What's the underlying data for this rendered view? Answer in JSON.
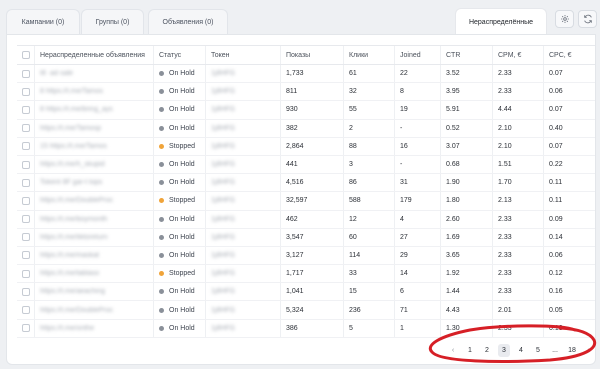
{
  "tabs": [
    {
      "label": "Кампании (0)",
      "active": false
    },
    {
      "label": "Группы (0)",
      "active": false
    },
    {
      "label": "Объявления (0)",
      "active": false
    },
    {
      "label": "Нераспределённые",
      "active": true
    }
  ],
  "toolbar": {
    "settings_icon": "gear-icon",
    "refresh_icon": "refresh-icon"
  },
  "table": {
    "headers": {
      "name": "Нераспределенные объявления",
      "status": "Статус",
      "token": "Токен",
      "shows": "Показы",
      "clicks": "Клики",
      "joined": "Joined",
      "ctr": "CTR",
      "cpm": "CPM, €",
      "cpc": "CPC, €"
    },
    "rows": [
      {
        "name": "t8 ·ad·sale",
        "status": "On Hold",
        "token": "1j8HFG",
        "shows": "1,733",
        "clicks": "61",
        "joined": "22",
        "ctr": "3.52",
        "cpm": "2.33",
        "cpc": "0.07"
      },
      {
        "name": "8 https://t.me/Tamos",
        "status": "On Hold",
        "token": "1j8HFG",
        "shows": "811",
        "clicks": "32",
        "joined": "8",
        "ctr": "3.95",
        "cpm": "2.33",
        "cpc": "0.06"
      },
      {
        "name": "8 https://t.me/bring_ays",
        "status": "On Hold",
        "token": "1j8HFG",
        "shows": "930",
        "clicks": "55",
        "joined": "19",
        "ctr": "5.91",
        "cpm": "4.44",
        "cpc": "0.07"
      },
      {
        "name": "https://t.me/Tamosp",
        "status": "On Hold",
        "token": "1j8HFG",
        "shows": "382",
        "clicks": "2",
        "joined": "-",
        "ctr": "0.52",
        "cpm": "2.10",
        "cpc": "0.40"
      },
      {
        "name": "15 https://t.me/Tamos",
        "status": "Stopped",
        "token": "1j8HFG",
        "shows": "2,864",
        "clicks": "88",
        "joined": "16",
        "ctr": "3.07",
        "cpm": "2.10",
        "cpc": "0.07"
      },
      {
        "name": "https://t.me/h_skupid",
        "status": "On Hold",
        "token": "1j8HFG",
        "shows": "441",
        "clicks": "3",
        "joined": "-",
        "ctr": "0.68",
        "cpm": "1.51",
        "cpc": "0.22"
      },
      {
        "name": "Tokent 8F gar-t tops",
        "status": "On Hold",
        "token": "1j8HFG",
        "shows": "4,516",
        "clicks": "86",
        "joined": "31",
        "ctr": "1.90",
        "cpm": "1.70",
        "cpc": "0.11"
      },
      {
        "name": "https://t.me/DoubleProc",
        "status": "Stopped",
        "token": "1j8HFG",
        "shows": "32,597",
        "clicks": "588",
        "joined": "179",
        "ctr": "1.80",
        "cpm": "2.13",
        "cpc": "0.11"
      },
      {
        "name": "https://t.me/boymonth",
        "status": "On Hold",
        "token": "1j8HFG",
        "shows": "462",
        "clicks": "12",
        "joined": "4",
        "ctr": "2.60",
        "cpm": "2.33",
        "cpc": "0.09"
      },
      {
        "name": "https://t.me/tiktoreturn",
        "status": "On Hold",
        "token": "1j8HFG",
        "shows": "3,547",
        "clicks": "60",
        "joined": "27",
        "ctr": "1.69",
        "cpm": "2.33",
        "cpc": "0.14"
      },
      {
        "name": "https://t.me/maskat",
        "status": "On Hold",
        "token": "1j8HFG",
        "shows": "3,127",
        "clicks": "114",
        "joined": "29",
        "ctr": "3.65",
        "cpm": "2.33",
        "cpc": "0.06"
      },
      {
        "name": "https://t.me/tablaso",
        "status": "Stopped",
        "token": "1j8HFG",
        "shows": "1,717",
        "clicks": "33",
        "joined": "14",
        "ctr": "1.92",
        "cpm": "2.33",
        "cpc": "0.12"
      },
      {
        "name": "https://t.me/aeaching",
        "status": "On Hold",
        "token": "1j8HFG",
        "shows": "1,041",
        "clicks": "15",
        "joined": "6",
        "ctr": "1.44",
        "cpm": "2.33",
        "cpc": "0.16"
      },
      {
        "name": "https://t.me/DoubleProc",
        "status": "On Hold",
        "token": "1j8HFG",
        "shows": "5,324",
        "clicks": "236",
        "joined": "71",
        "ctr": "4.43",
        "cpm": "2.01",
        "cpc": "0.05"
      },
      {
        "name": "https://t.me/onthe",
        "status": "On Hold",
        "token": "1j8HFG",
        "shows": "386",
        "clicks": "5",
        "joined": "1",
        "ctr": "1.30",
        "cpm": "2.33",
        "cpc": "0.18"
      }
    ]
  },
  "pagination": {
    "prev": "‹",
    "pages": [
      "1",
      "2",
      "3",
      "4",
      "5"
    ],
    "ellipsis": "...",
    "last": "18",
    "next": "›",
    "current": "3"
  },
  "colors": {
    "stopped": "#f0a43a",
    "on_hold": "#8a9099",
    "annotation": "#d61f26"
  }
}
